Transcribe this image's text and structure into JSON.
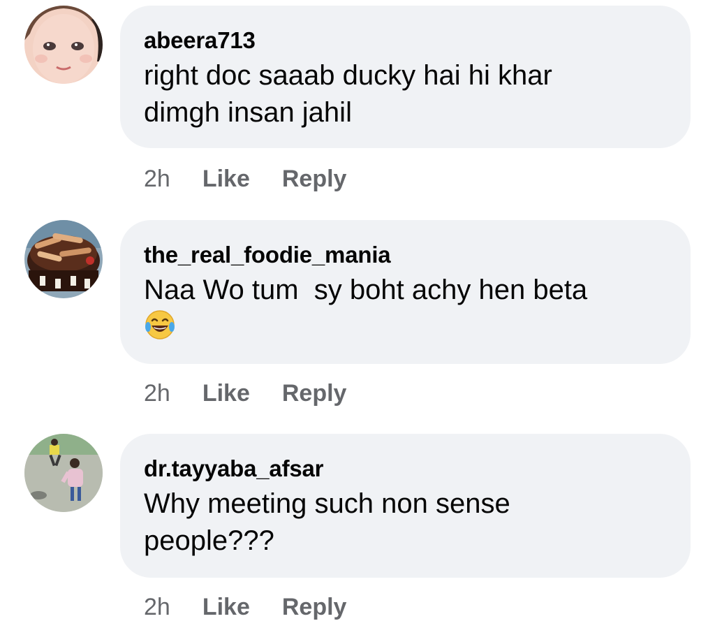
{
  "comments": [
    {
      "username": "abeera713",
      "text": "right doc saaab ducky hai hi khar dimgh insan jahil",
      "time": "2h",
      "like_label": "Like",
      "reply_label": "Reply",
      "avatar_icon": "baby-face-avatar"
    },
    {
      "username": "the_real_foodie_mania",
      "text": "Naa Wo tum  sy boht achy hen beta",
      "emoji": "😂",
      "time": "2h",
      "like_label": "Like",
      "reply_label": "Reply",
      "avatar_icon": "chocolate-cake-avatar"
    },
    {
      "username": "dr.tayyaba_afsar",
      "text": "Why meeting such non sense people???",
      "time": "2h",
      "like_label": "Like",
      "reply_label": "Reply",
      "avatar_icon": "children-playing-avatar"
    }
  ],
  "colors": {
    "bubble_background": "#f0f2f5",
    "text_primary": "#050505",
    "text_secondary": "#65676b"
  }
}
